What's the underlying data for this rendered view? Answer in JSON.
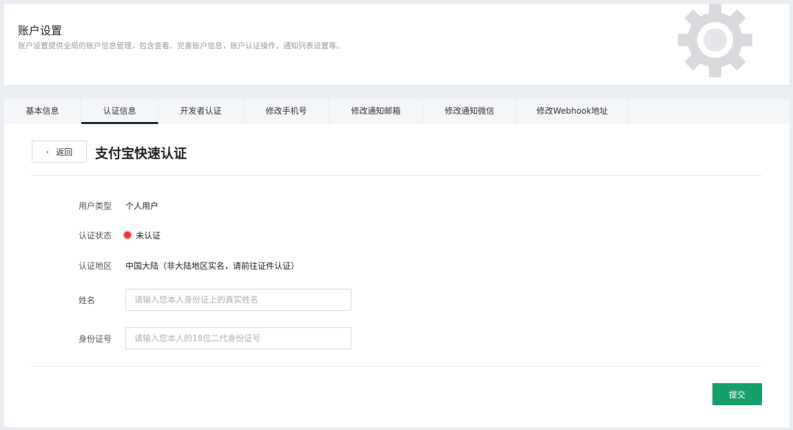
{
  "header": {
    "title": "账户设置",
    "description": "账户设置提供全局的账户信息管理，包含查看、完善账户信息，账户认证操作，通知列表设置等。"
  },
  "tabs": [
    {
      "label": "基本信息",
      "active": false
    },
    {
      "label": "认证信息",
      "active": true
    },
    {
      "label": "开发者认证",
      "active": false
    },
    {
      "label": "修改手机号",
      "active": false
    },
    {
      "label": "修改通知邮箱",
      "active": false
    },
    {
      "label": "修改通知微信",
      "active": false
    },
    {
      "label": "修改Webhook地址",
      "active": false
    }
  ],
  "page": {
    "back_label": "返回",
    "title": "支付宝快速认证"
  },
  "form": {
    "user_type_label": "用户类型",
    "user_type_value": "个人用户",
    "status_label": "认证状态",
    "status_value": "未认证",
    "region_label": "认证地区",
    "region_value": "中国大陆（非大陆地区实名，请前往证件认证）",
    "name_label": "姓名",
    "name_placeholder": "请输入您本人身份证上的真实姓名",
    "id_label": "身份证号",
    "id_placeholder": "请输入您本人的18位二代身份证号",
    "submit_label": "提交"
  },
  "colors": {
    "accent": "#15a06a",
    "status_error": "#e8383d",
    "active_tab_indicator": "#1e2a36"
  }
}
